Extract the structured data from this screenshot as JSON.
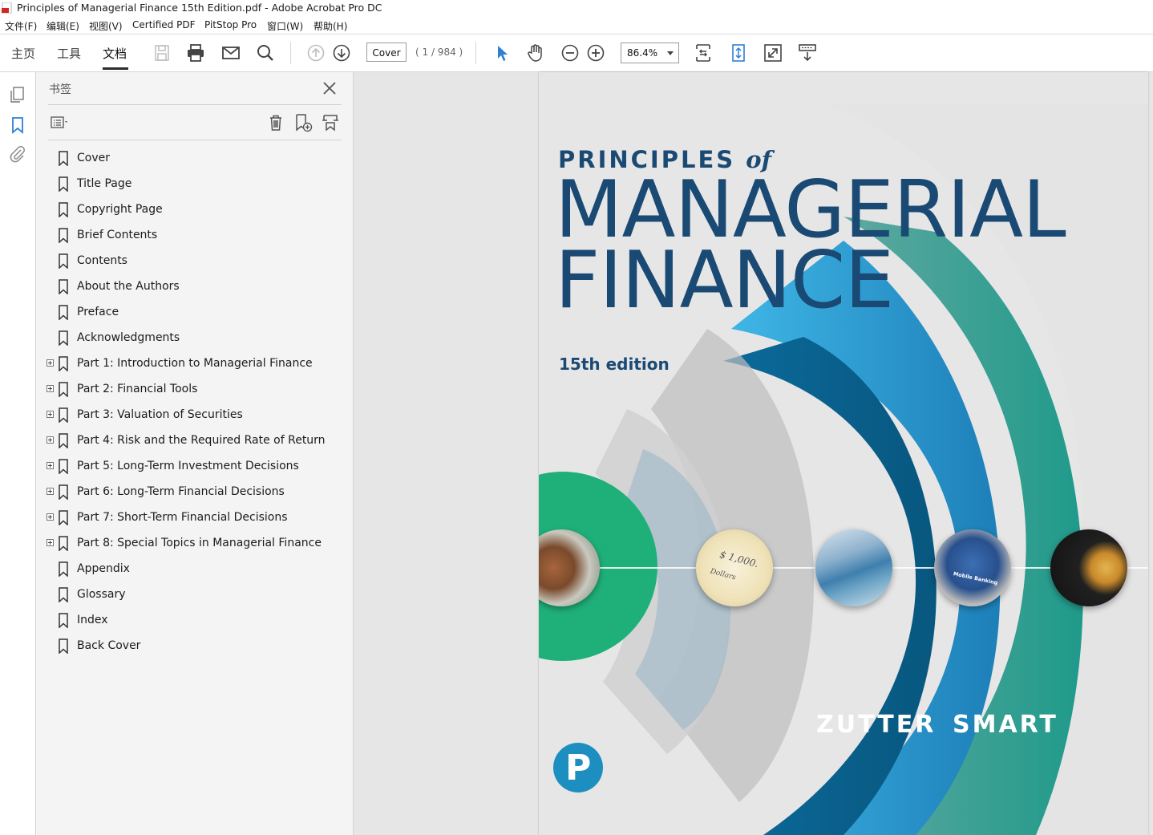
{
  "window": {
    "title": "Principles of Managerial Finance 15th Edition.pdf - Adobe Acrobat Pro DC"
  },
  "menu": [
    "文件(F)",
    "编辑(E)",
    "视图(V)",
    "Certified PDF",
    "PitStop Pro",
    "窗口(W)",
    "帮助(H)"
  ],
  "toolbar": {
    "tabs": [
      "主页",
      "工具",
      "文档"
    ],
    "active_tab": "文档",
    "page_label": "Cover",
    "page_count": "( 1 / 984 )",
    "zoom": "86.4%"
  },
  "bookmarks_panel": {
    "title": "书签",
    "items": [
      {
        "label": "Cover",
        "expandable": false
      },
      {
        "label": "Title Page",
        "expandable": false
      },
      {
        "label": "Copyright Page",
        "expandable": false
      },
      {
        "label": "Brief Contents",
        "expandable": false
      },
      {
        "label": "Contents",
        "expandable": false
      },
      {
        "label": "About the Authors",
        "expandable": false
      },
      {
        "label": "Preface",
        "expandable": false
      },
      {
        "label": "Acknowledgments",
        "expandable": false
      },
      {
        "label": "Part 1: Introduction to Managerial Finance",
        "expandable": true
      },
      {
        "label": "Part 2: Financial Tools",
        "expandable": true
      },
      {
        "label": "Part 3: Valuation of Securities",
        "expandable": true
      },
      {
        "label": "Part 4: Risk and the Required Rate of Return",
        "expandable": true
      },
      {
        "label": "Part 5: Long-Term Investment Decisions",
        "expandable": true
      },
      {
        "label": "Part 6: Long-Term Financial Decisions",
        "expandable": true
      },
      {
        "label": "Part 7: Short-Term Financial Decisions",
        "expandable": true
      },
      {
        "label": "Part 8: Special Topics in Managerial Finance",
        "expandable": true
      },
      {
        "label": "Appendix",
        "expandable": false
      },
      {
        "label": "Glossary",
        "expandable": false
      },
      {
        "label": "Index",
        "expandable": false
      },
      {
        "label": "Back Cover",
        "expandable": false
      }
    ]
  },
  "cover": {
    "principles": "PRINCIPLES",
    "of": "of",
    "title_line1": "MANAGERIAL",
    "title_line2": "FINANCE",
    "edition": "15th edition",
    "author1": "ZUTTER",
    "author2": "SMART",
    "publisher_logo_letter": "P"
  },
  "colors": {
    "accent_blue": "#2f7fd6",
    "cover_navy": "#1a4a73",
    "cover_teal": "#1f9a8a",
    "cover_green": "#1fb07a",
    "cover_lightblue": "#3fb6e6"
  }
}
